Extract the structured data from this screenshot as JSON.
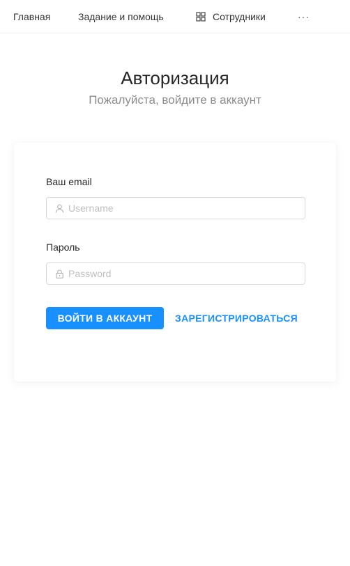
{
  "nav": {
    "items": [
      {
        "label": "Главная"
      },
      {
        "label": "Задание и помощь"
      },
      {
        "label": "Сотрудники",
        "icon": "grid-icon"
      }
    ],
    "more_label": "···"
  },
  "header": {
    "title": "Авторизация",
    "subtitle": "Пожалуйста, войдите в аккаунт"
  },
  "form": {
    "email_label": "Ваш email",
    "email_placeholder": "Username",
    "email_icon": "user-icon",
    "password_label": "Пароль",
    "password_placeholder": "Password",
    "password_icon": "lock-icon",
    "login_button": "ВОЙТИ В АККАУНТ",
    "register_link": "ЗАРЕГИСТРИРОВАТЬСЯ"
  },
  "colors": {
    "accent": "#1890ff",
    "muted_text": "#8c8c8c",
    "border": "#d9d9d9"
  }
}
